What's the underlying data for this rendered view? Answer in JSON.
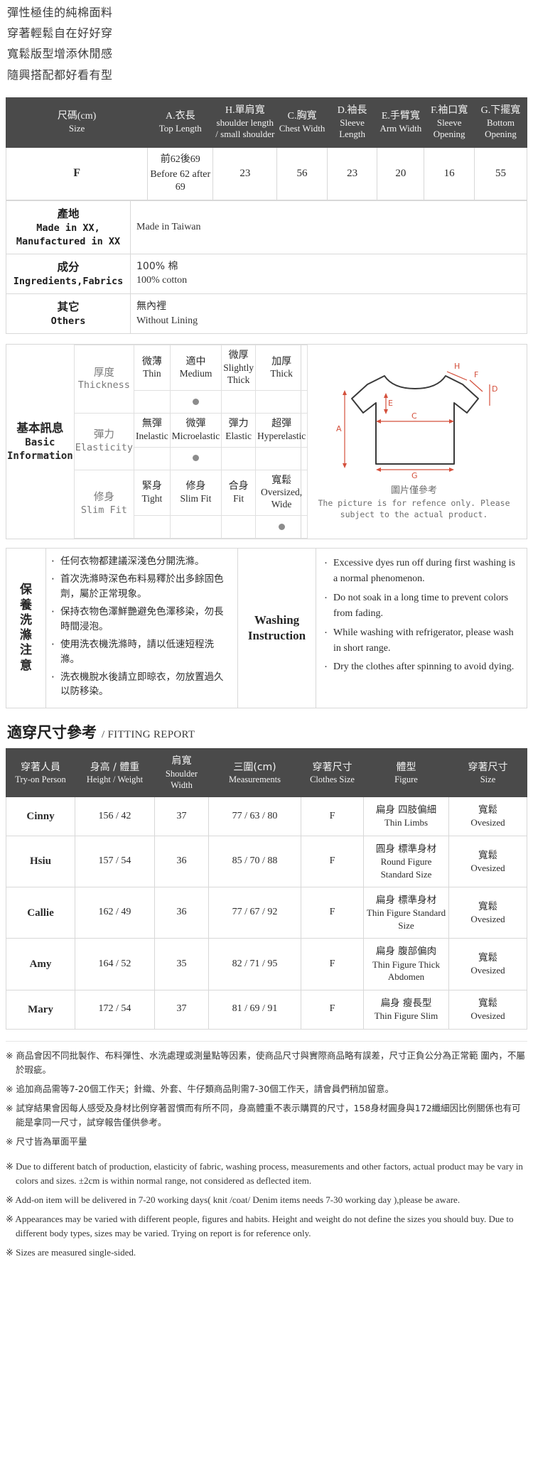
{
  "intro": {
    "lines": [
      "彈性極佳的純棉面料",
      "穿著輕鬆自在好好穿",
      "寬鬆版型增添休閒感",
      "隨興搭配都好看有型"
    ]
  },
  "size_table": {
    "headers": [
      {
        "cn": "尺碼(cm)",
        "en": "Size"
      },
      {
        "cn": "A.衣長",
        "en": "Top Length"
      },
      {
        "cn": "H.單肩寬",
        "en": "shoulder length / small shoulder"
      },
      {
        "cn": "C.胸寬",
        "en": "Chest Width"
      },
      {
        "cn": "D.袖長",
        "en": "Sleeve Length"
      },
      {
        "cn": "E.手臂寬",
        "en": "Arm Width"
      },
      {
        "cn": "F.袖口寬",
        "en": "Sleeve Opening"
      },
      {
        "cn": "G.下擺寬",
        "en": "Bottom Opening"
      }
    ],
    "rows": [
      {
        "size": "F",
        "top_length_cn": "前62後69",
        "top_length_en": "Before 62 after 69",
        "shoulder": "23",
        "chest": "56",
        "sleeve_length": "23",
        "arm_width": "20",
        "sleeve_opening": "16",
        "bottom_opening": "55"
      }
    ]
  },
  "info_rows": [
    {
      "label_cn": "產地",
      "label_en": "Made in XX, Manufactured in XX",
      "value_cn": "",
      "value_en": "Made in Taiwan"
    },
    {
      "label_cn": "成分",
      "label_en": "Ingredients,Fabrics",
      "value_cn": "100% 棉",
      "value_en": "100% cotton"
    },
    {
      "label_cn": "其它",
      "label_en": "Others",
      "value_cn": "無內裡",
      "value_en": "Without Lining"
    }
  ],
  "basic_info": {
    "title_cn": "基本訊息",
    "title_en": "Basic Information",
    "rows": [
      {
        "label_cn": "厚度",
        "label_en": "Thickness",
        "options": [
          {
            "cn": "微薄",
            "en": "Thin",
            "selected": false
          },
          {
            "cn": "適中",
            "en": "Medium",
            "selected": true
          },
          {
            "cn": "微厚",
            "en": "Slightly Thick",
            "selected": false
          },
          {
            "cn": "加厚",
            "en": "Thick",
            "selected": false
          }
        ]
      },
      {
        "label_cn": "彈力",
        "label_en": "Elasticity",
        "options": [
          {
            "cn": "無彈",
            "en": "Inelastic",
            "selected": false
          },
          {
            "cn": "微彈",
            "en": "Microelastic",
            "selected": true
          },
          {
            "cn": "彈力",
            "en": "Elastic",
            "selected": false
          },
          {
            "cn": "超彈",
            "en": "Hyperelastic",
            "selected": false
          }
        ]
      },
      {
        "label_cn": "修身",
        "label_en": "Slim Fit",
        "options": [
          {
            "cn": "緊身",
            "en": "Tight",
            "selected": false
          },
          {
            "cn": "修身",
            "en": "Slim Fit",
            "selected": false
          },
          {
            "cn": "合身",
            "en": "Fit",
            "selected": false
          },
          {
            "cn": "寬鬆",
            "en": "Oversized, Wide",
            "selected": true
          }
        ]
      }
    ],
    "diagram": {
      "labels": [
        "A",
        "C",
        "E",
        "G",
        "H",
        "F",
        "D"
      ],
      "caption_cn": "圖片僅參考",
      "caption_en": "The picture is for refence only. Please subject to the actual product."
    }
  },
  "washing": {
    "label_cn": "保養洗滌注意",
    "title_en": "Washing Instruction",
    "cn_items": [
      "任何衣物都建議深淺色分開洗滌。",
      "首次洗滌時深色布料易釋於出多餘固色劑，屬於正常現象。",
      "保持衣物色澤鮮艷避免色澤移染，勿長時間浸泡。",
      "使用洗衣機洗滌時，請以低速短程洗滌。",
      "洗衣機脫水後請立即晾衣，勿放置過久以防移染。"
    ],
    "en_items": [
      "Excessive dyes run off during first washing is a normal phenomenon.",
      "Do not soak in a long time to prevent colors from fading.",
      "While washing with refrigerator, please wash in short range.",
      "Dry the clothes after spinning to avoid dying."
    ]
  },
  "fitting_report": {
    "title_cn": "適穿尺寸參考",
    "title_en": "/ FITTING REPORT",
    "headers": [
      {
        "cn": "穿著人員",
        "en": "Try-on Person"
      },
      {
        "cn": "身高 / 體重",
        "en": "Height / Weight"
      },
      {
        "cn": "肩寬",
        "en": "Shoulder Width"
      },
      {
        "cn": "三圍(cm)",
        "en": "Measurements"
      },
      {
        "cn": "穿著尺寸",
        "en": "Clothes Size"
      },
      {
        "cn": "體型",
        "en": "Figure"
      },
      {
        "cn": "穿著尺寸",
        "en": "Size"
      }
    ],
    "rows": [
      {
        "person": "Cinny",
        "height_weight": "156 / 42",
        "shoulder": "37",
        "measurements": "77 / 63 / 80",
        "clothes_size": "F",
        "figure_cn": "扁身 四肢偏細",
        "figure_en": "Thin Limbs",
        "size_cn": "寬鬆",
        "size_en": "Ovesized"
      },
      {
        "person": "Hsiu",
        "height_weight": "157 / 54",
        "shoulder": "36",
        "measurements": "85 / 70 / 88",
        "clothes_size": "F",
        "figure_cn": "圓身 標準身材",
        "figure_en": "Round Figure Standard Size",
        "size_cn": "寬鬆",
        "size_en": "Ovesized"
      },
      {
        "person": "Callie",
        "height_weight": "162 / 49",
        "shoulder": "36",
        "measurements": "77 / 67 / 92",
        "clothes_size": "F",
        "figure_cn": "扁身 標準身材",
        "figure_en": "Thin Figure Standard Size",
        "size_cn": "寬鬆",
        "size_en": "Ovesized"
      },
      {
        "person": "Amy",
        "height_weight": "164 / 52",
        "shoulder": "35",
        "measurements": "82 / 71 / 95",
        "clothes_size": "F",
        "figure_cn": "扁身 腹部偏肉",
        "figure_en": "Thin Figure Thick Abdomen",
        "size_cn": "寬鬆",
        "size_en": "Ovesized"
      },
      {
        "person": "Mary",
        "height_weight": "172 / 54",
        "shoulder": "37",
        "measurements": "81 / 69 / 91",
        "clothes_size": "F",
        "figure_cn": "扁身 瘦長型",
        "figure_en": "Thin Figure Slim",
        "size_cn": "寬鬆",
        "size_en": "Ovesized"
      }
    ]
  },
  "notes": {
    "cn": [
      "※ 商品會因不同批製作、布料彈性、水洗處理或測量點等因素，使商品尺寸與實際商品略有誤差，尺寸正負公分為正常範 圍內，不屬於瑕疵。",
      "※ 追加商品需等7-20個工作天；針織、外套、牛仔類商品則需7-30個工作天，請會員們稍加留意。",
      "※ 試穿結果會因每人感受及身材比例穿著習慣而有所不同，身高體重不表示購買的尺寸，158身材圓身與172纖細因比例關係也有可能是拿同一尺寸，試穿報告僅供參考。",
      "※ 尺寸皆為單面平量"
    ],
    "en": [
      "※ Due to different batch of production, elasticity of fabric, washing process, measurements and other factors, actual product may be vary in colors and sizes. ±2cm is within normal range, not considered as deflected item.",
      "※ Add-on item will be delivered in 7-20 working days( knit /coat/ Denim items needs 7-30 working day ),please be aware.",
      "※ Appearances may be varied with different people, figures and habits. Height and weight do not define the sizes you should buy. Due to different body types, sizes may be varied. Trying on report is for reference only.",
      "※ Sizes are measured single-sided."
    ]
  }
}
